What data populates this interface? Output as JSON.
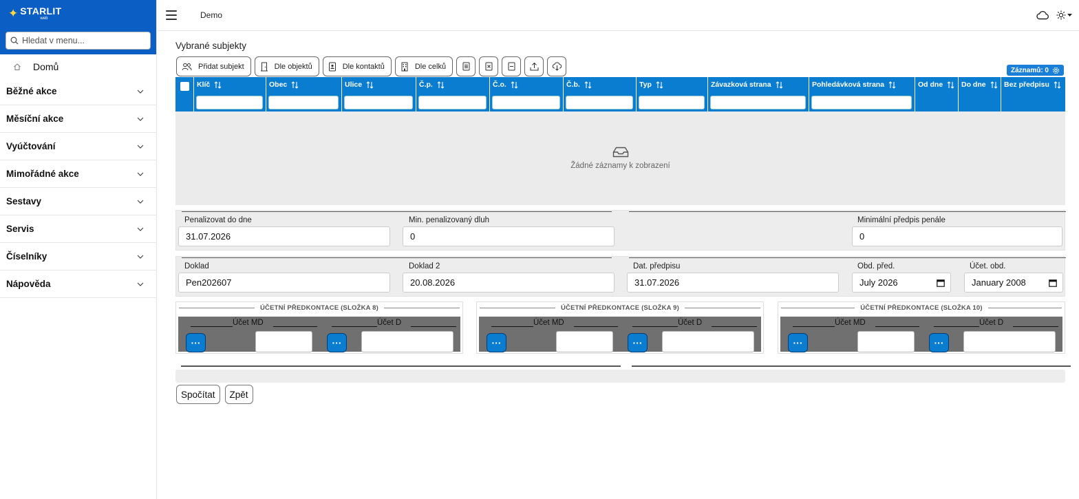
{
  "app": {
    "brand": "STARLIT",
    "brand_sub": "web",
    "header_title": "Demo"
  },
  "sidebar": {
    "search_placeholder": "Hledat v menu...",
    "home": "Domů",
    "groups": [
      "Běžné akce",
      "Měsíční akce",
      "Vyúčtování",
      "Mimořádné akce",
      "Sestavy",
      "Servis",
      "Číselníky",
      "Nápověda"
    ]
  },
  "main": {
    "section_title": "Vybrané subjekty",
    "toolbar": {
      "add_subject": "Přidat subjekt",
      "by_objects": "Dle objektů",
      "by_contacts": "Dle kontaktů",
      "by_units": "Dle celků"
    },
    "records_label": "Záznamů: 0",
    "columns": [
      "Klíč",
      "Obec",
      "Ulice",
      "Č.p.",
      "Č.o.",
      "Č.b.",
      "Typ",
      "Závazková strana",
      "Pohledávková strana",
      "Od dne",
      "Do dne",
      "Bez předpisu"
    ],
    "empty_text": "Žádné záznamy k zobrazení"
  },
  "form": {
    "penalize_label": "Penalizovat do dne",
    "penalize_value": "31.07.2026",
    "min_debt_label": "Min. penalizovaný dluh",
    "min_debt_value": "0",
    "min_penalty_label": "Minimální předpis penále",
    "min_penalty_value": "0",
    "doc_label": "Doklad",
    "doc_value": "Pen202607",
    "doc2_label": "Doklad 2",
    "doc2_value": "20.08.2026",
    "date_label": "Dat. předpisu",
    "date_value": "31.07.2026",
    "period_label": "Obd. před.",
    "period_value": "July 2026",
    "acc_period_label": "Účet. obd.",
    "acc_period_value": "January 2008"
  },
  "accounting": {
    "groups": [
      {
        "title": "ÚČETNÍ PŘEDKONTACE (SLOŽKA 8)"
      },
      {
        "title": "ÚČETNÍ PŘEDKONTACE (SLOŽKA 9)"
      },
      {
        "title": "ÚČETNÍ PŘEDKONTACE (SLOŽKA 10)"
      }
    ],
    "md_label": "Účet MD",
    "d_label": "Účet D",
    "picker_label": "···"
  },
  "actions": {
    "calculate": "Spočítat",
    "back": "Zpět"
  }
}
